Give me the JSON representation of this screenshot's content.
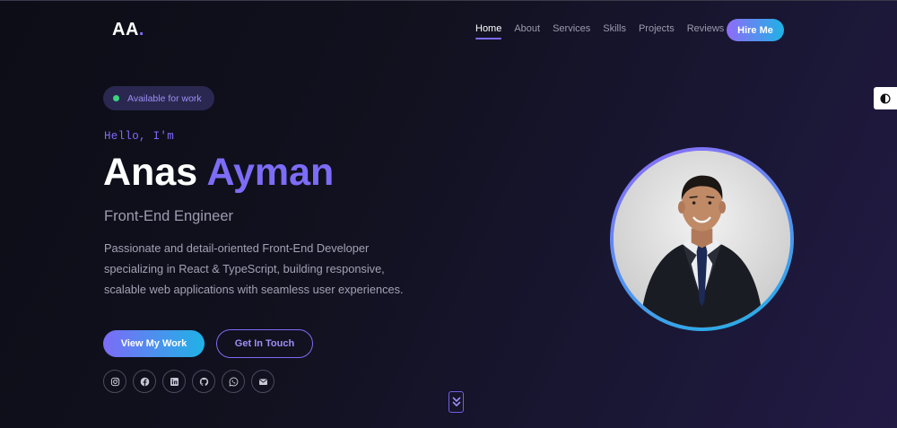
{
  "brand": {
    "logo_text": "AA",
    "logo_dot": "."
  },
  "nav": {
    "items": [
      {
        "label": "Home",
        "active": true
      },
      {
        "label": "About",
        "active": false
      },
      {
        "label": "Services",
        "active": false
      },
      {
        "label": "Skills",
        "active": false
      },
      {
        "label": "Projects",
        "active": false
      },
      {
        "label": "Reviews",
        "active": false
      }
    ],
    "cta_label": "Hire Me"
  },
  "theme_toggle": {
    "icon": "contrast-icon"
  },
  "hero": {
    "badge": "Available for work",
    "greeting": "Hello, I'm",
    "first_name": "Anas",
    "last_name": "Ayman",
    "role": "Front-End Engineer",
    "description": "Passionate and detail-oriented Front-End Developer specializing in React & TypeScript, building responsive, scalable web applications with seamless user experiences.",
    "primary_button": "View My Work",
    "secondary_button": "Get In Touch",
    "socials": [
      "instagram-icon",
      "facebook-icon",
      "linkedin-icon",
      "github-icon",
      "whatsapp-icon",
      "email-icon"
    ],
    "scroll_icon": "chevrons-down-icon"
  },
  "colors": {
    "accent": "#7c6cf6",
    "accent_cyan": "#1fb2e6",
    "status_green": "#3ad47e",
    "background": "#11111f"
  }
}
